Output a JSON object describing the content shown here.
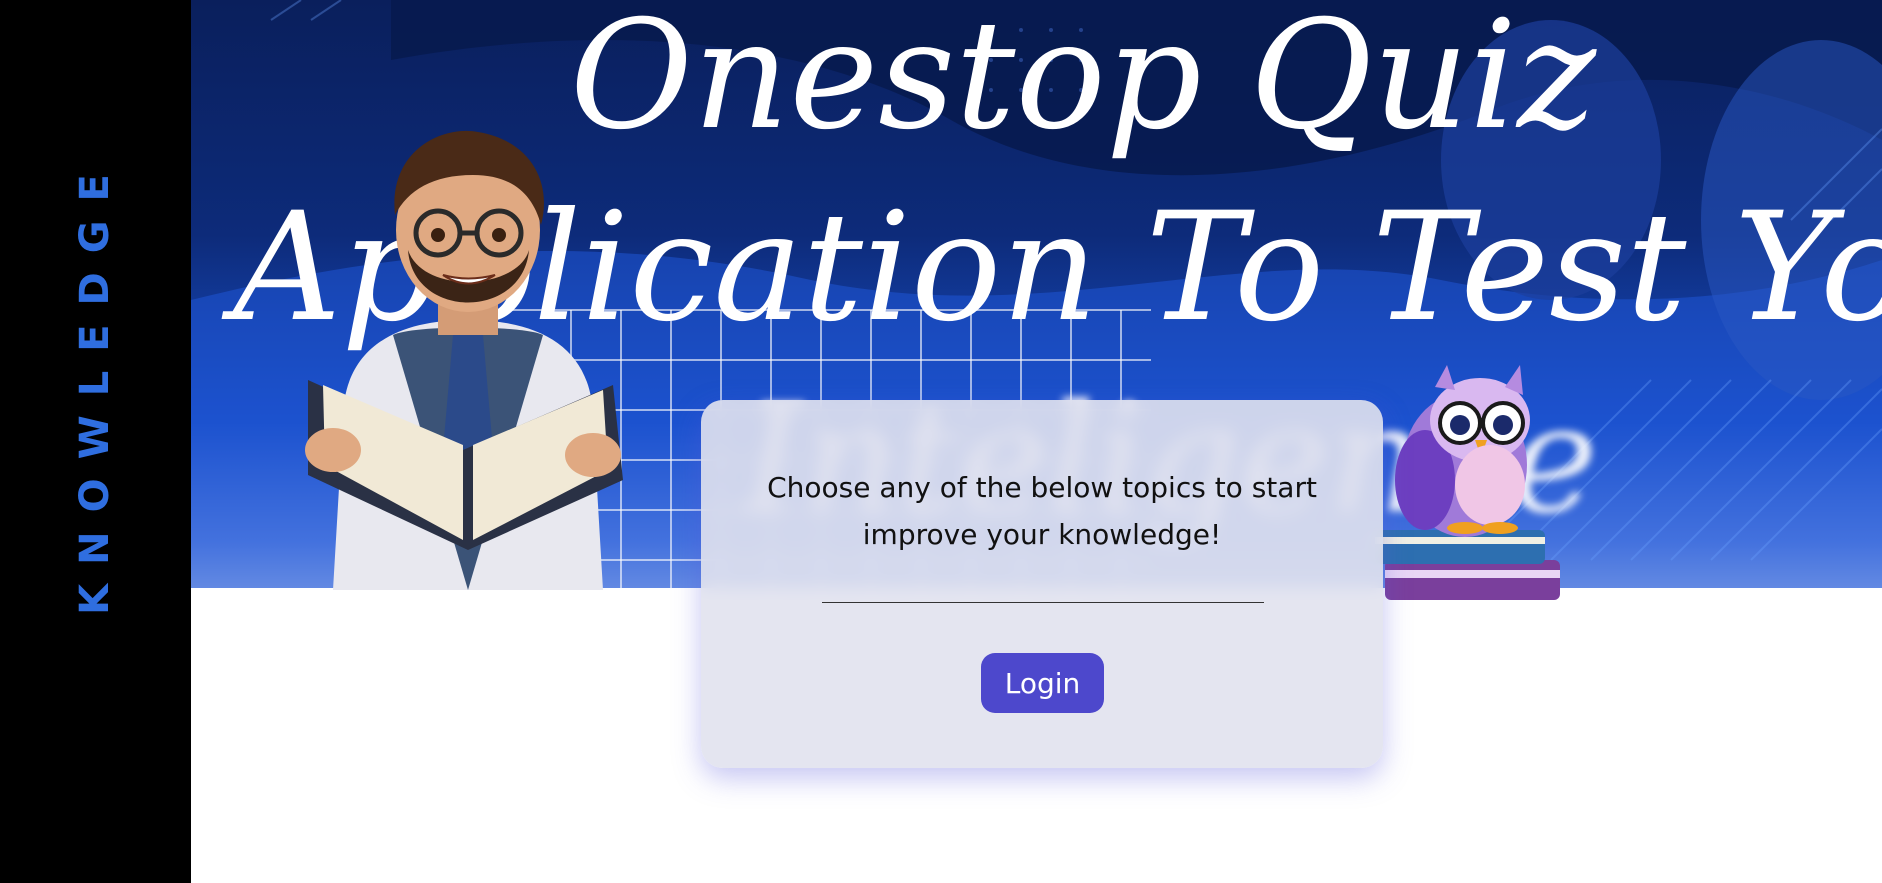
{
  "sidebar": {
    "label": "KNOWLEDGE"
  },
  "hero": {
    "title_line1": "Onestop Quiz",
    "title_line2": "Application To Test  Your",
    "title_line3": "Inteligence"
  },
  "card": {
    "message_line1": "Choose any of the below topics to start",
    "message_line2": "improve your knowledge!",
    "login_label": "Login"
  },
  "colors": {
    "sidebar_bg": "#000000",
    "sidebar_text": "#2f6ee0",
    "hero_dark": "#0a1f5c",
    "hero_mid": "#1a4fc8",
    "button": "#4d48cc",
    "card_bg": "#e1e2ee"
  },
  "icons": [
    "teacher-illustration",
    "owl-illustration"
  ]
}
